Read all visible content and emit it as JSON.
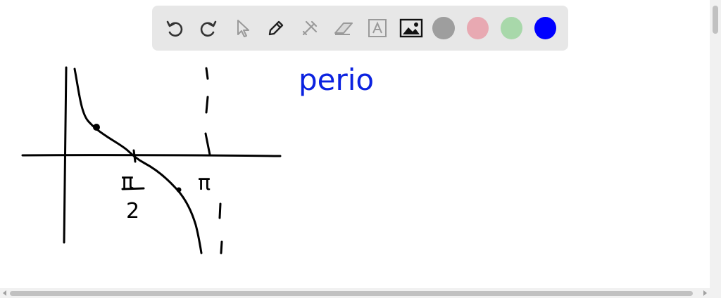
{
  "toolbar": {
    "tools": [
      {
        "id": "undo",
        "icon": "undo-icon"
      },
      {
        "id": "redo",
        "icon": "redo-icon"
      },
      {
        "id": "select",
        "icon": "pointer-icon"
      },
      {
        "id": "pen",
        "icon": "pen-icon"
      },
      {
        "id": "tools",
        "icon": "tools-icon"
      },
      {
        "id": "eraser",
        "icon": "eraser-icon"
      },
      {
        "id": "text",
        "icon": "text-box-icon"
      },
      {
        "id": "image",
        "icon": "image-icon"
      }
    ],
    "colors": [
      "#9e9e9e",
      "#e8a9b2",
      "#a8d8aa",
      "#0000ff"
    ]
  },
  "drawing": {
    "handwritten_text": "perio",
    "pi_label": "π",
    "half_pi_numerator": "π",
    "half_pi_denominator": "2",
    "ink_color": "#0b22e0"
  }
}
